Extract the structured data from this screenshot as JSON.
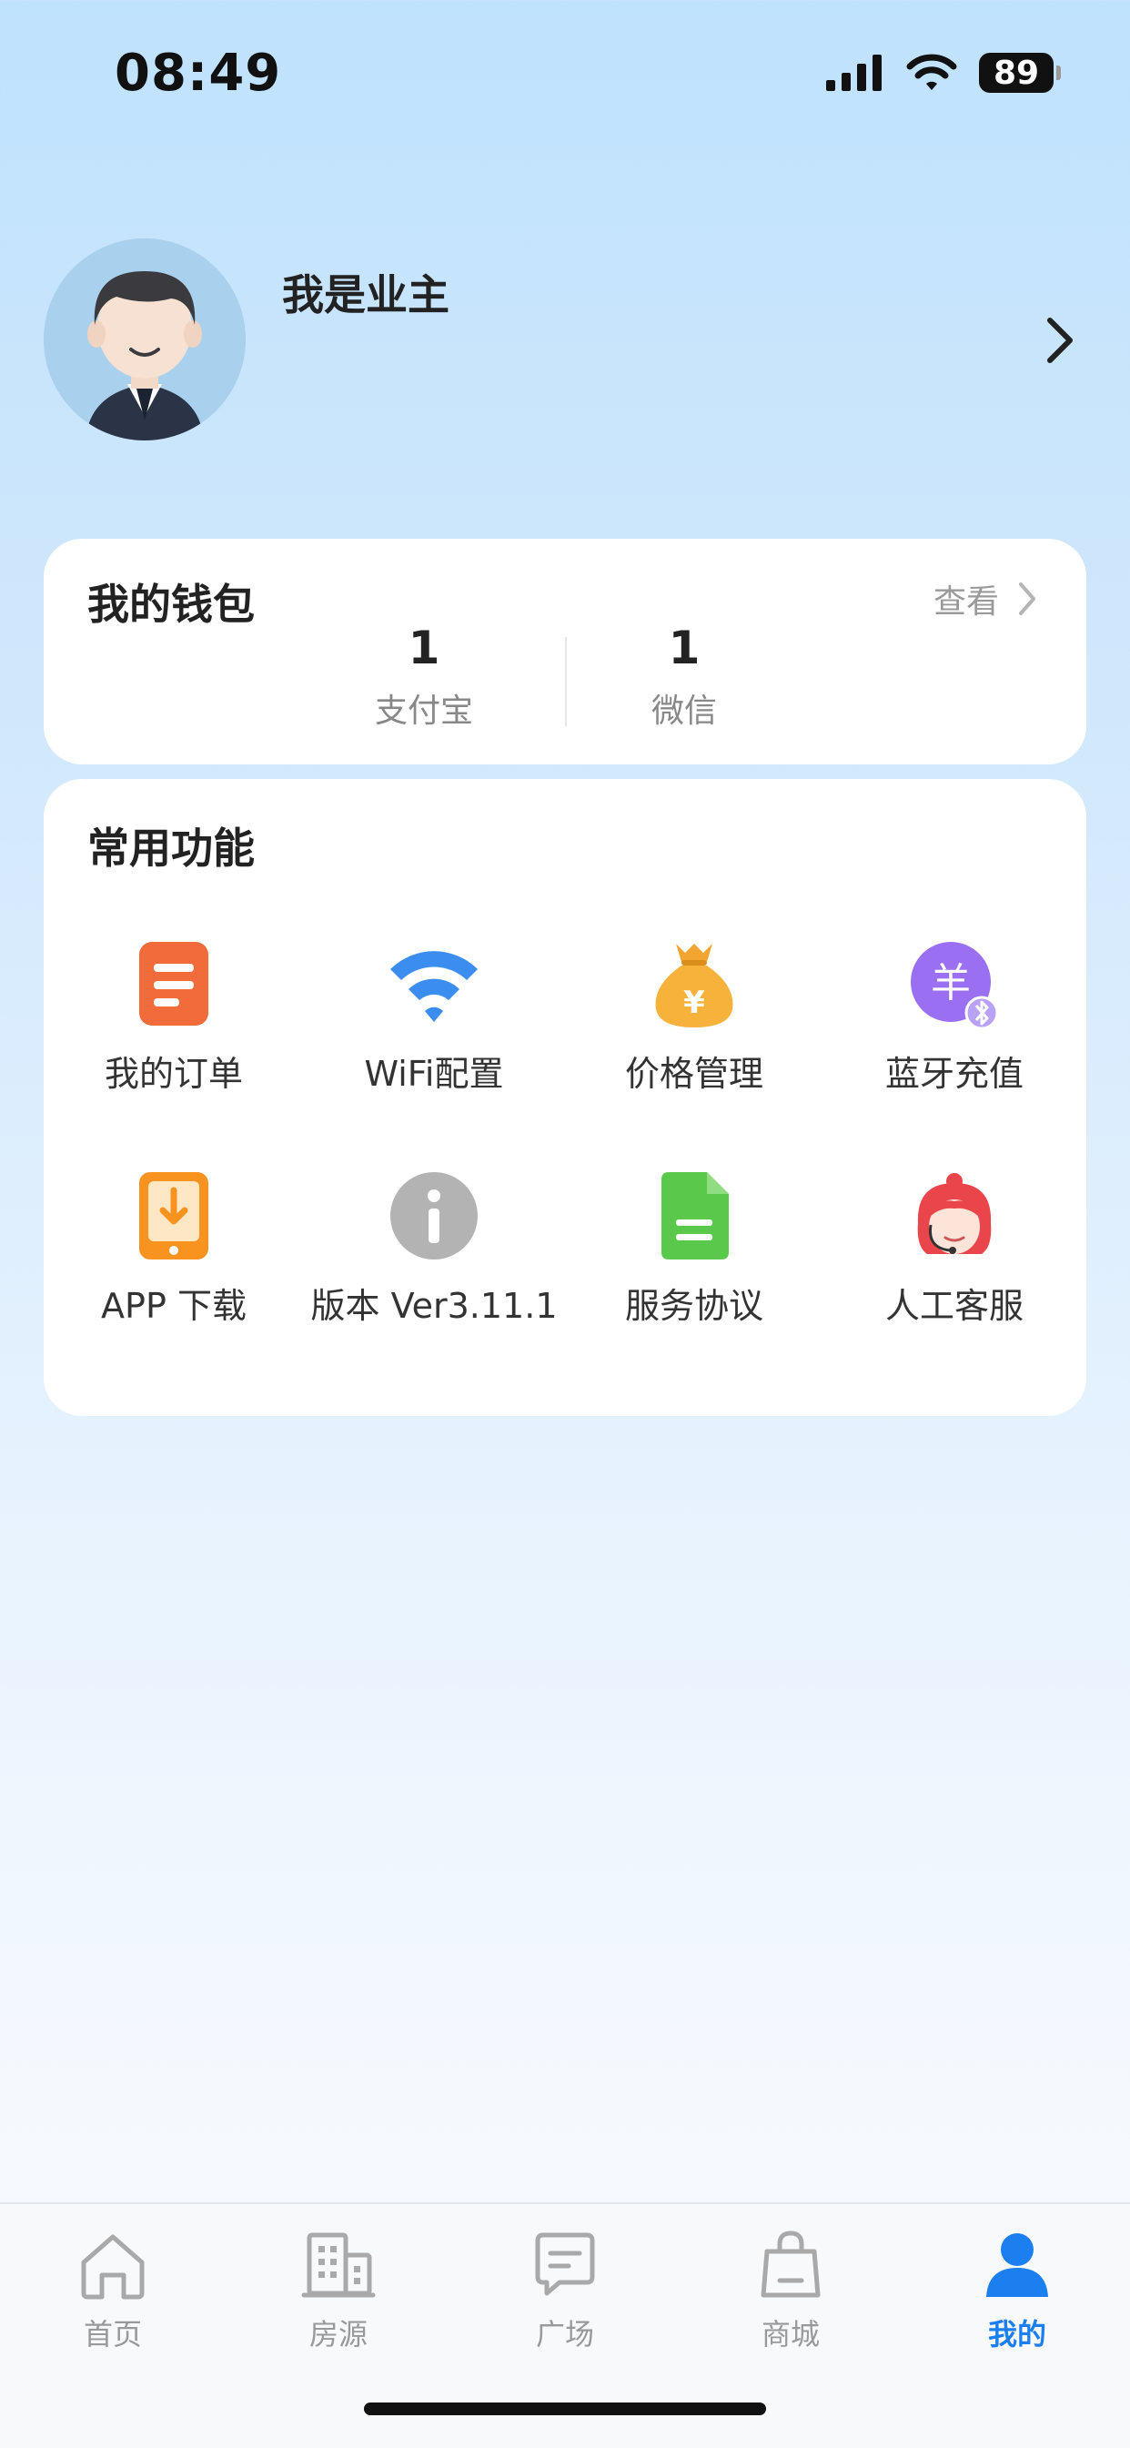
{
  "status_bar": {
    "time": "08:49",
    "battery": "89"
  },
  "profile": {
    "name": "我是业主"
  },
  "wallet": {
    "title": "我的钱包",
    "view_label": "查看",
    "items": [
      {
        "value": "1",
        "label": "支付宝"
      },
      {
        "value": "1",
        "label": "微信"
      }
    ]
  },
  "functions": {
    "title": "常用功能",
    "items": [
      {
        "label": "我的订单",
        "icon": "order-icon"
      },
      {
        "label": "WiFi配置",
        "icon": "wifi-icon"
      },
      {
        "label": "价格管理",
        "icon": "money-bag-icon"
      },
      {
        "label": "蓝牙充值",
        "icon": "bluetooth-recharge-icon"
      },
      {
        "label": "APP 下载",
        "icon": "download-icon"
      },
      {
        "label": "版本 Ver3.11.1",
        "icon": "info-icon"
      },
      {
        "label": "服务协议",
        "icon": "document-icon"
      },
      {
        "label": "人工客服",
        "icon": "customer-service-icon"
      }
    ]
  },
  "tab_bar": {
    "items": [
      {
        "label": "首页",
        "icon": "home-icon"
      },
      {
        "label": "房源",
        "icon": "building-icon"
      },
      {
        "label": "广场",
        "icon": "chat-icon"
      },
      {
        "label": "商城",
        "icon": "shopping-bag-icon"
      },
      {
        "label": "我的",
        "icon": "user-icon",
        "active": true
      }
    ],
    "active_color": "#1b7ff0",
    "inactive_color": "#999999"
  }
}
